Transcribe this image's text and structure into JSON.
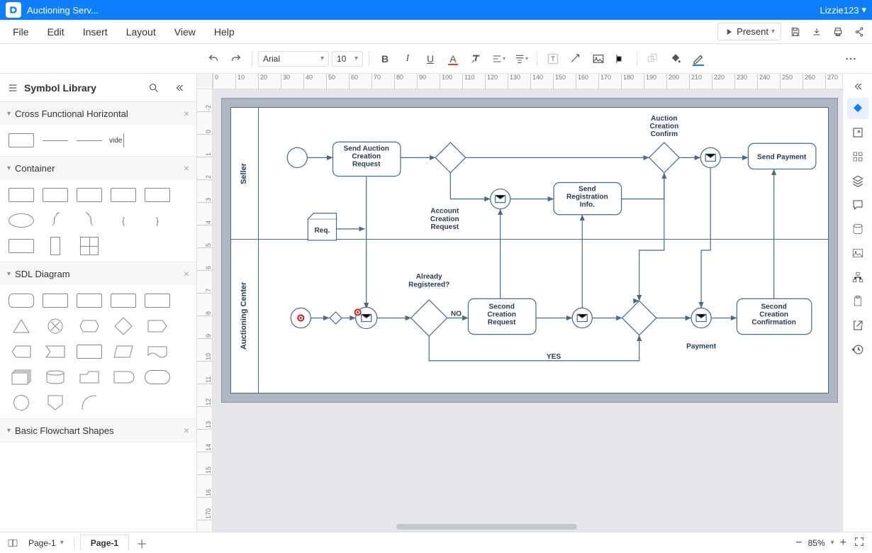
{
  "app": {
    "doc_title": "Auctioning Serv...",
    "user": "Lizzie123"
  },
  "menubar": {
    "items": [
      "File",
      "Edit",
      "Insert",
      "Layout",
      "View",
      "Help"
    ],
    "present": "Present"
  },
  "toolbar": {
    "font": "Arial",
    "font_size": "10"
  },
  "library": {
    "title": "Symbol Library",
    "sections": [
      {
        "name": "Cross Functional Horizontal"
      },
      {
        "name": "Container"
      },
      {
        "name": "SDL Diagram"
      },
      {
        "name": "Basic Flowchart Shapes"
      }
    ],
    "shape_label_vide": "vide"
  },
  "ruler": {
    "h": [
      "0",
      "10",
      "20",
      "30",
      "40",
      "50",
      "60",
      "70",
      "80",
      "90",
      "100",
      "110",
      "120",
      "130",
      "140",
      "150",
      "160",
      "170",
      "180",
      "190",
      "200",
      "210",
      "220",
      "230",
      "240",
      "250",
      "260",
      "270"
    ],
    "v": [
      "-2",
      "0",
      "1",
      "2",
      "3",
      "4",
      "5",
      "6",
      "7",
      "8",
      "9",
      "10",
      "11",
      "12",
      "13",
      "14",
      "15",
      "16",
      "170"
    ]
  },
  "diagram": {
    "lanes": {
      "seller": "Seller",
      "center": "Auctioning Center"
    },
    "nodes": {
      "send_auction_req": "Send Auction\nCreation\nRequest",
      "req": "Req.",
      "account_creation_req": "Account\nCreation\nRequest",
      "auction_creation_confirm": "Auction\nCreation\nConfirm",
      "send_reg_info": "Send\nRegistration\nInfo.",
      "send_payment": "Send Payment",
      "already_registered": "Already\nRegistered?",
      "second_creation_req": "Second\nCreation\nRequest",
      "payment": "Payment",
      "second_creation_conf": "Second\nCreation\nConfirmation",
      "no": "NO",
      "yes": "YES"
    }
  },
  "pages": {
    "selector": "Page-1",
    "active_tab": "Page-1"
  },
  "status": {
    "zoom": "85%"
  }
}
